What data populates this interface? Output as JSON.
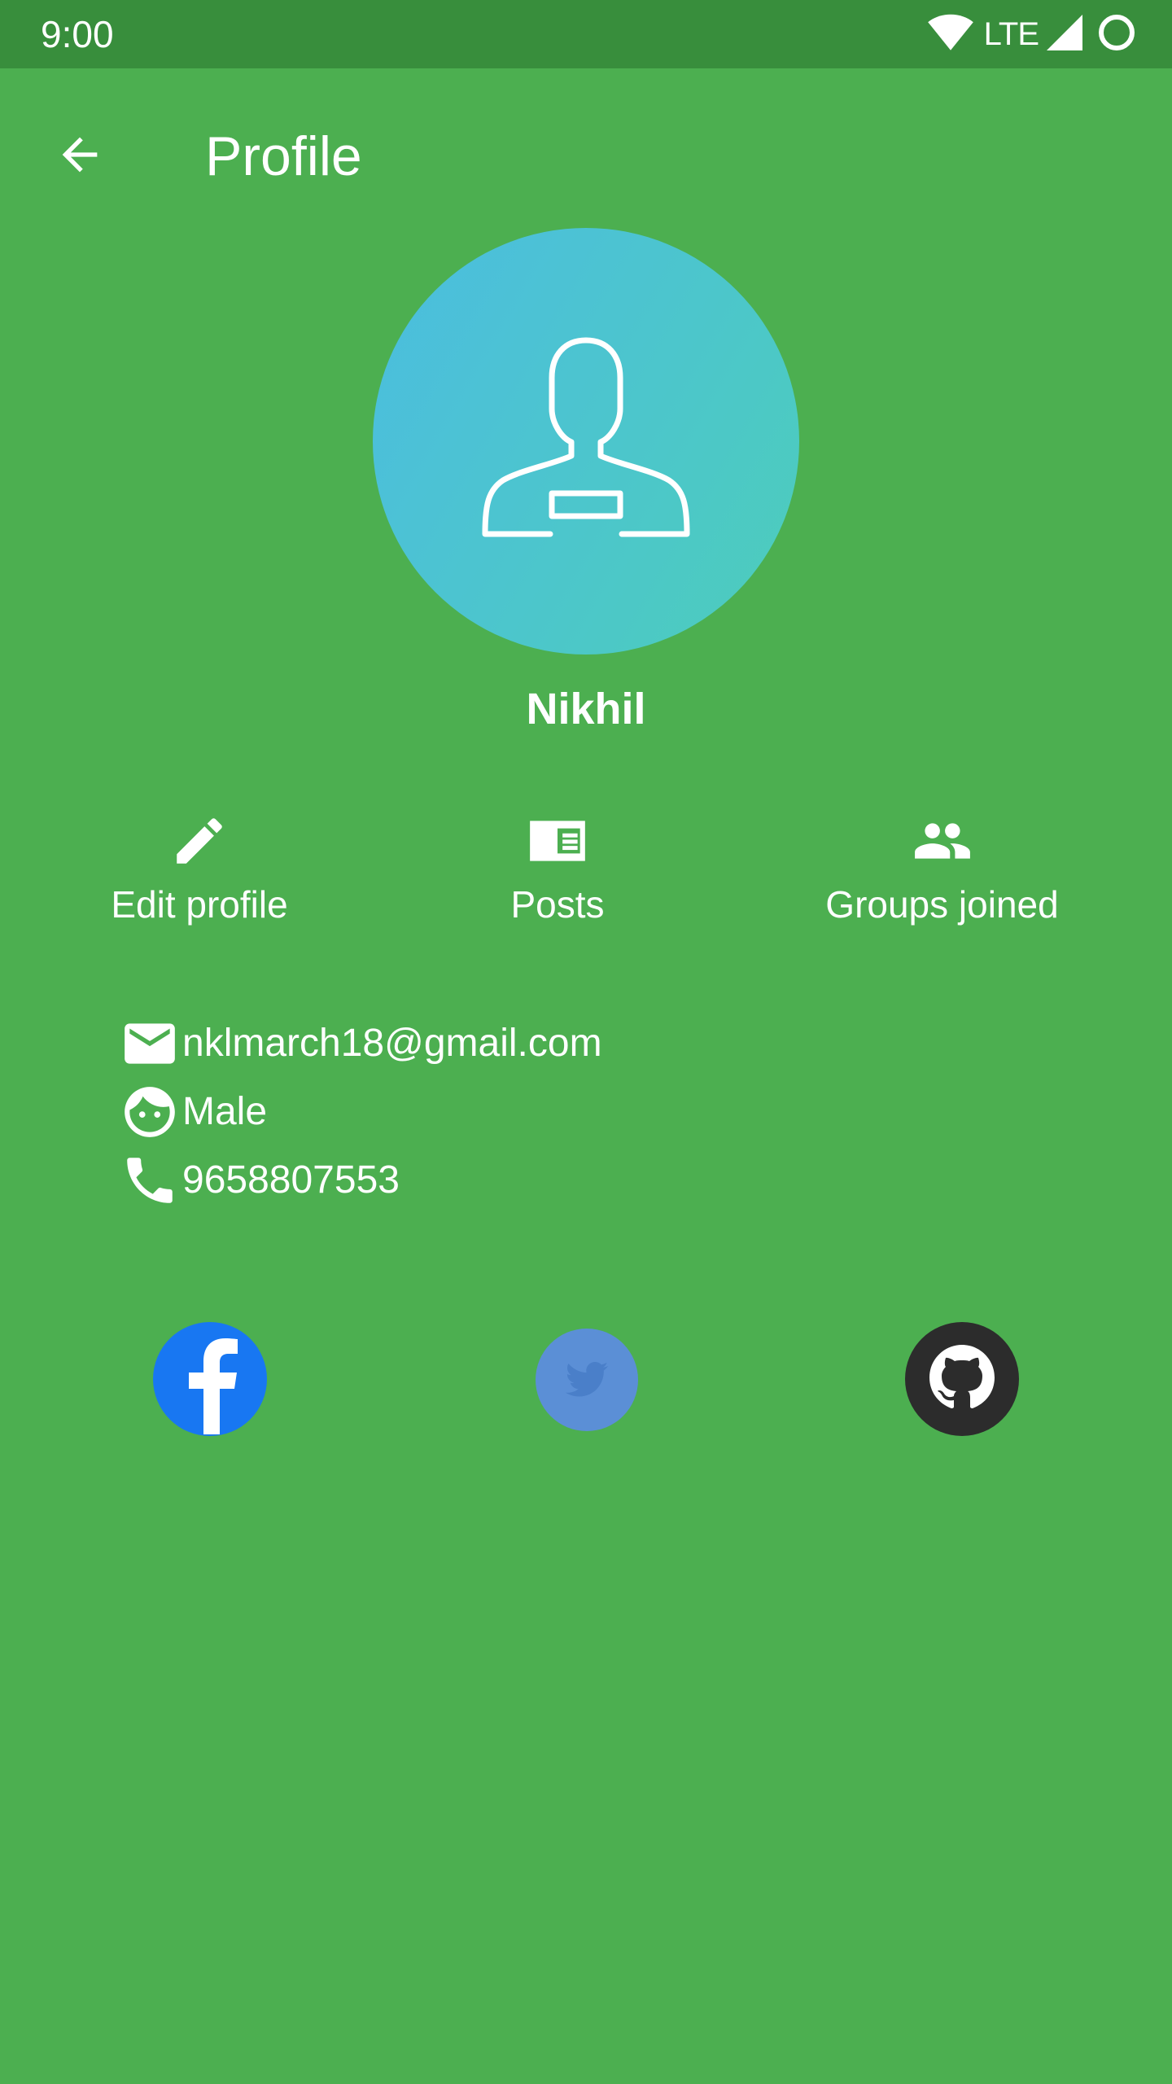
{
  "status_bar": {
    "time": "9:00",
    "network": "LTE"
  },
  "app_bar": {
    "title": "Profile"
  },
  "profile": {
    "name": "Nikhil"
  },
  "actions": [
    {
      "label": "Edit profile",
      "icon": "pencil-icon"
    },
    {
      "label": "Posts",
      "icon": "article-icon"
    },
    {
      "label": "Groups joined",
      "icon": "group-icon"
    }
  ],
  "contact": {
    "email": "nklmarch18@gmail.com",
    "gender": "Male",
    "phone": "9658807553"
  },
  "social": [
    {
      "name": "facebook",
      "icon": "facebook-icon",
      "color": "#1877f2"
    },
    {
      "name": "twitter",
      "icon": "twitter-icon",
      "color": "#5b8fd6"
    },
    {
      "name": "github",
      "icon": "github-icon",
      "color": "#2c2c2c"
    }
  ],
  "colors": {
    "background": "#4caf50",
    "status_bar": "#388e3c",
    "avatar_gradient_start": "#4bbde0",
    "avatar_gradient_end": "#4dcdbb"
  }
}
